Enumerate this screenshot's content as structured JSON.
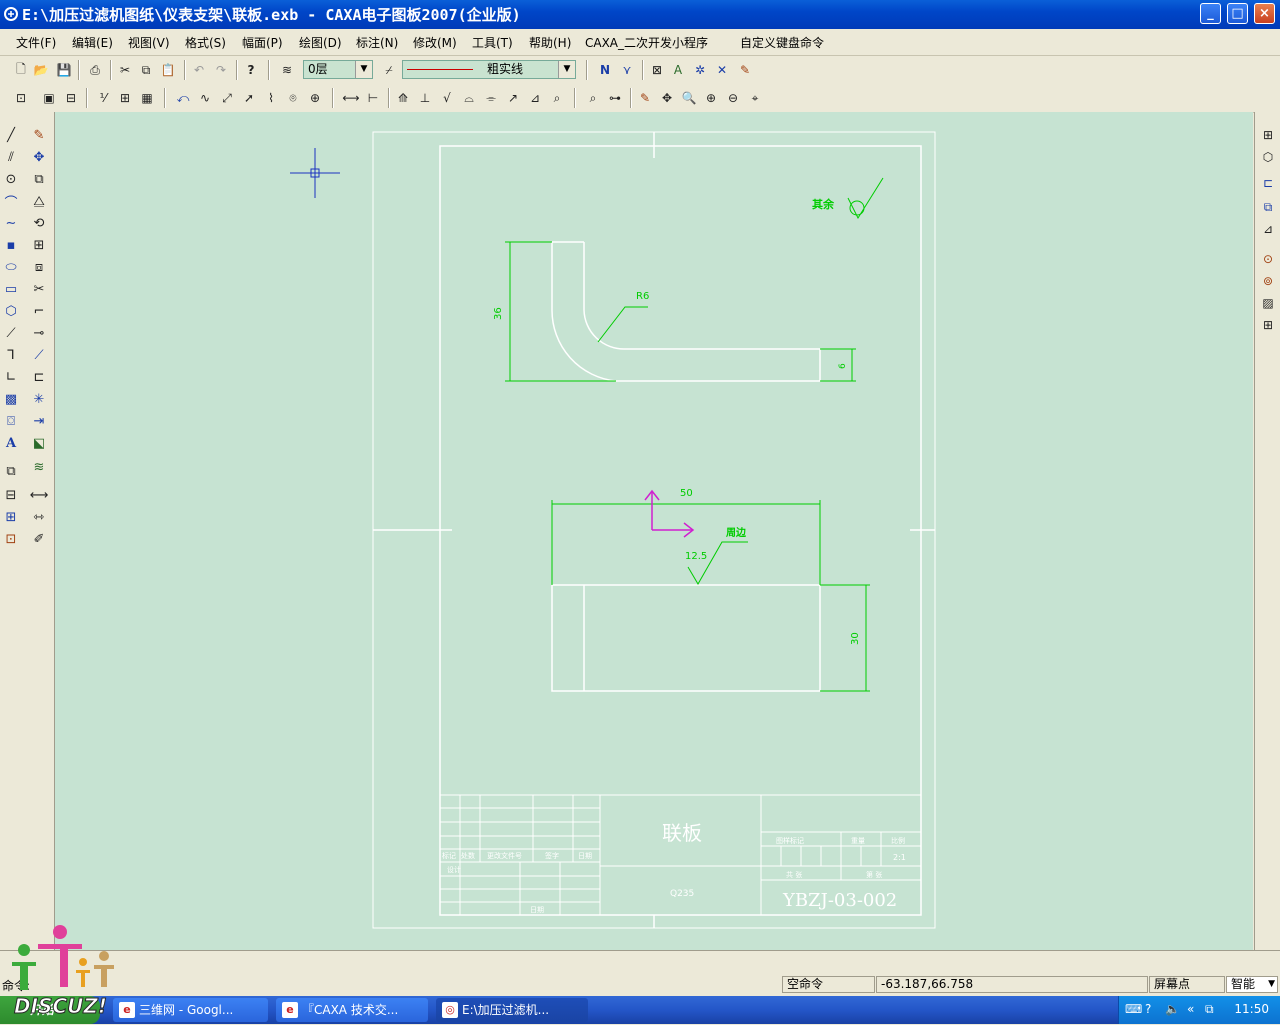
{
  "window": {
    "title": "E:\\加压过滤机图纸\\仪表支架\\联板.exb - CAXA电子图板2007(企业版)",
    "min": "_",
    "max": "□",
    "close": "×"
  },
  "menu": [
    "文件(F)",
    "编辑(E)",
    "视图(V)",
    "格式(S)",
    "幅面(P)",
    "绘图(D)",
    "标注(N)",
    "修改(M)",
    "工具(T)",
    "帮助(H)",
    "CAXA_二次开发小程序",
    "自定义键盘命令"
  ],
  "toolbar": {
    "layer": "0层",
    "linetype": "粗实线"
  },
  "drawing": {
    "roughness_note": "其余",
    "radius_label": "R6",
    "dim_height_top": "36",
    "dim_thickness": "6",
    "dim_width": "50",
    "through_label": "周边",
    "roughness_value": "12.5",
    "dim_height_bottom": "30",
    "part_name": "联板",
    "material": "Q235",
    "drawing_no": "YBZJ-03-002",
    "scale": "2:1",
    "tb_mark": "标记",
    "tb_count": "处数",
    "tb_doc": "更改文件号",
    "tb_sign": "签字",
    "tb_date": "日期",
    "tb_design": "设计",
    "tb_approve": "日期",
    "tb_stage": "图样标记",
    "tb_weight": "重量",
    "tb_ratio": "比例",
    "tb_sheets": "共 张",
    "tb_sheet": "第 张"
  },
  "command": {
    "prompt": "命令:"
  },
  "status": {
    "command_state": "空命令",
    "coords": "-63.187,66.758",
    "snap_label": "屏幕点",
    "snap_mode": "智能"
  },
  "taskbar": {
    "start": "开始",
    "tasks": [
      "三维网 - Googl...",
      "『CAXA 技术交...",
      "E:\\加压过滤机..."
    ],
    "clock": "11:50"
  },
  "watermark": "DISCUZ!"
}
